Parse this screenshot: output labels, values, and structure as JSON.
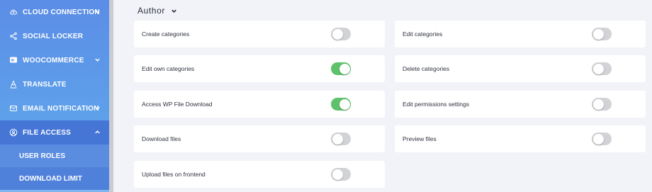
{
  "sidebar": {
    "items": [
      {
        "label": "CLOUD CONNECTION",
        "icon": "cloud-icon",
        "has_chevron": true
      },
      {
        "label": "SOCIAL LOCKER",
        "icon": "share-icon",
        "has_chevron": false
      },
      {
        "label": "WOOCOMMERCE",
        "icon": "woocommerce-icon",
        "has_chevron": true
      },
      {
        "label": "TRANSLATE",
        "icon": "translate-icon",
        "has_chevron": false
      },
      {
        "label": "EMAIL NOTIFICATION",
        "icon": "mail-icon",
        "has_chevron": true
      },
      {
        "label": "FILE ACCESS",
        "icon": "user-circle-icon",
        "has_chevron": true,
        "expanded": true
      }
    ],
    "sub_items": [
      {
        "label": "USER ROLES",
        "selected": true
      },
      {
        "label": "DOWNLOAD LIMIT",
        "selected": false
      }
    ]
  },
  "role": {
    "label": "Author"
  },
  "permissions": [
    {
      "label": "Create categories",
      "enabled": false
    },
    {
      "label": "Edit categories",
      "enabled": false
    },
    {
      "label": "Edit own categories",
      "enabled": true
    },
    {
      "label": "Delete categories",
      "enabled": false
    },
    {
      "label": "Access WP File Download",
      "enabled": true
    },
    {
      "label": "Edit permissions settings",
      "enabled": false
    },
    {
      "label": "Download files",
      "enabled": false
    },
    {
      "label": "Preview files",
      "enabled": false
    },
    {
      "label": "Upload files on frontend",
      "enabled": false
    }
  ],
  "colors": {
    "sidebar": "#5b8de6",
    "toggle_on": "#5ec26a",
    "toggle_off": "#d2d3d6"
  }
}
